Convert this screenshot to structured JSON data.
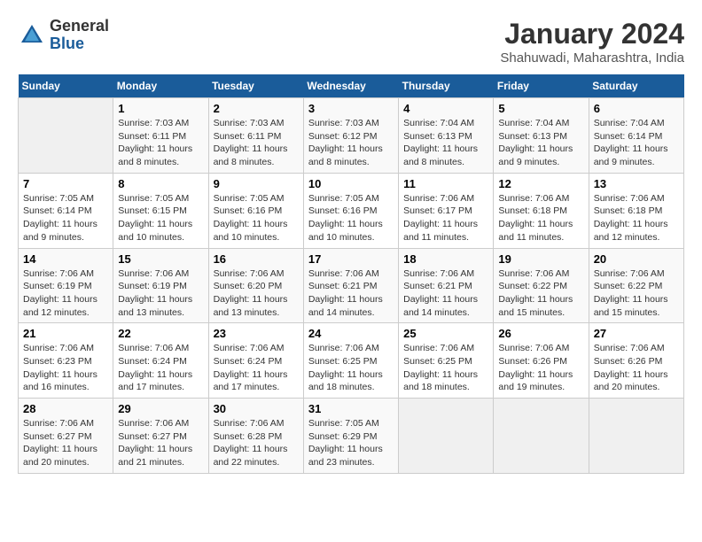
{
  "header": {
    "logo_general": "General",
    "logo_blue": "Blue",
    "title": "January 2024",
    "subtitle": "Shahuwadi, Maharashtra, India"
  },
  "days_of_week": [
    "Sunday",
    "Monday",
    "Tuesday",
    "Wednesday",
    "Thursday",
    "Friday",
    "Saturday"
  ],
  "weeks": [
    [
      {
        "num": "",
        "info": ""
      },
      {
        "num": "1",
        "info": "Sunrise: 7:03 AM\nSunset: 6:11 PM\nDaylight: 11 hours and 8 minutes."
      },
      {
        "num": "2",
        "info": "Sunrise: 7:03 AM\nSunset: 6:11 PM\nDaylight: 11 hours and 8 minutes."
      },
      {
        "num": "3",
        "info": "Sunrise: 7:03 AM\nSunset: 6:12 PM\nDaylight: 11 hours and 8 minutes."
      },
      {
        "num": "4",
        "info": "Sunrise: 7:04 AM\nSunset: 6:13 PM\nDaylight: 11 hours and 8 minutes."
      },
      {
        "num": "5",
        "info": "Sunrise: 7:04 AM\nSunset: 6:13 PM\nDaylight: 11 hours and 9 minutes."
      },
      {
        "num": "6",
        "info": "Sunrise: 7:04 AM\nSunset: 6:14 PM\nDaylight: 11 hours and 9 minutes."
      }
    ],
    [
      {
        "num": "7",
        "info": "Sunrise: 7:05 AM\nSunset: 6:14 PM\nDaylight: 11 hours and 9 minutes."
      },
      {
        "num": "8",
        "info": "Sunrise: 7:05 AM\nSunset: 6:15 PM\nDaylight: 11 hours and 10 minutes."
      },
      {
        "num": "9",
        "info": "Sunrise: 7:05 AM\nSunset: 6:16 PM\nDaylight: 11 hours and 10 minutes."
      },
      {
        "num": "10",
        "info": "Sunrise: 7:05 AM\nSunset: 6:16 PM\nDaylight: 11 hours and 10 minutes."
      },
      {
        "num": "11",
        "info": "Sunrise: 7:06 AM\nSunset: 6:17 PM\nDaylight: 11 hours and 11 minutes."
      },
      {
        "num": "12",
        "info": "Sunrise: 7:06 AM\nSunset: 6:18 PM\nDaylight: 11 hours and 11 minutes."
      },
      {
        "num": "13",
        "info": "Sunrise: 7:06 AM\nSunset: 6:18 PM\nDaylight: 11 hours and 12 minutes."
      }
    ],
    [
      {
        "num": "14",
        "info": "Sunrise: 7:06 AM\nSunset: 6:19 PM\nDaylight: 11 hours and 12 minutes."
      },
      {
        "num": "15",
        "info": "Sunrise: 7:06 AM\nSunset: 6:19 PM\nDaylight: 11 hours and 13 minutes."
      },
      {
        "num": "16",
        "info": "Sunrise: 7:06 AM\nSunset: 6:20 PM\nDaylight: 11 hours and 13 minutes."
      },
      {
        "num": "17",
        "info": "Sunrise: 7:06 AM\nSunset: 6:21 PM\nDaylight: 11 hours and 14 minutes."
      },
      {
        "num": "18",
        "info": "Sunrise: 7:06 AM\nSunset: 6:21 PM\nDaylight: 11 hours and 14 minutes."
      },
      {
        "num": "19",
        "info": "Sunrise: 7:06 AM\nSunset: 6:22 PM\nDaylight: 11 hours and 15 minutes."
      },
      {
        "num": "20",
        "info": "Sunrise: 7:06 AM\nSunset: 6:22 PM\nDaylight: 11 hours and 15 minutes."
      }
    ],
    [
      {
        "num": "21",
        "info": "Sunrise: 7:06 AM\nSunset: 6:23 PM\nDaylight: 11 hours and 16 minutes."
      },
      {
        "num": "22",
        "info": "Sunrise: 7:06 AM\nSunset: 6:24 PM\nDaylight: 11 hours and 17 minutes."
      },
      {
        "num": "23",
        "info": "Sunrise: 7:06 AM\nSunset: 6:24 PM\nDaylight: 11 hours and 17 minutes."
      },
      {
        "num": "24",
        "info": "Sunrise: 7:06 AM\nSunset: 6:25 PM\nDaylight: 11 hours and 18 minutes."
      },
      {
        "num": "25",
        "info": "Sunrise: 7:06 AM\nSunset: 6:25 PM\nDaylight: 11 hours and 18 minutes."
      },
      {
        "num": "26",
        "info": "Sunrise: 7:06 AM\nSunset: 6:26 PM\nDaylight: 11 hours and 19 minutes."
      },
      {
        "num": "27",
        "info": "Sunrise: 7:06 AM\nSunset: 6:26 PM\nDaylight: 11 hours and 20 minutes."
      }
    ],
    [
      {
        "num": "28",
        "info": "Sunrise: 7:06 AM\nSunset: 6:27 PM\nDaylight: 11 hours and 20 minutes."
      },
      {
        "num": "29",
        "info": "Sunrise: 7:06 AM\nSunset: 6:27 PM\nDaylight: 11 hours and 21 minutes."
      },
      {
        "num": "30",
        "info": "Sunrise: 7:06 AM\nSunset: 6:28 PM\nDaylight: 11 hours and 22 minutes."
      },
      {
        "num": "31",
        "info": "Sunrise: 7:05 AM\nSunset: 6:29 PM\nDaylight: 11 hours and 23 minutes."
      },
      {
        "num": "",
        "info": ""
      },
      {
        "num": "",
        "info": ""
      },
      {
        "num": "",
        "info": ""
      }
    ]
  ]
}
